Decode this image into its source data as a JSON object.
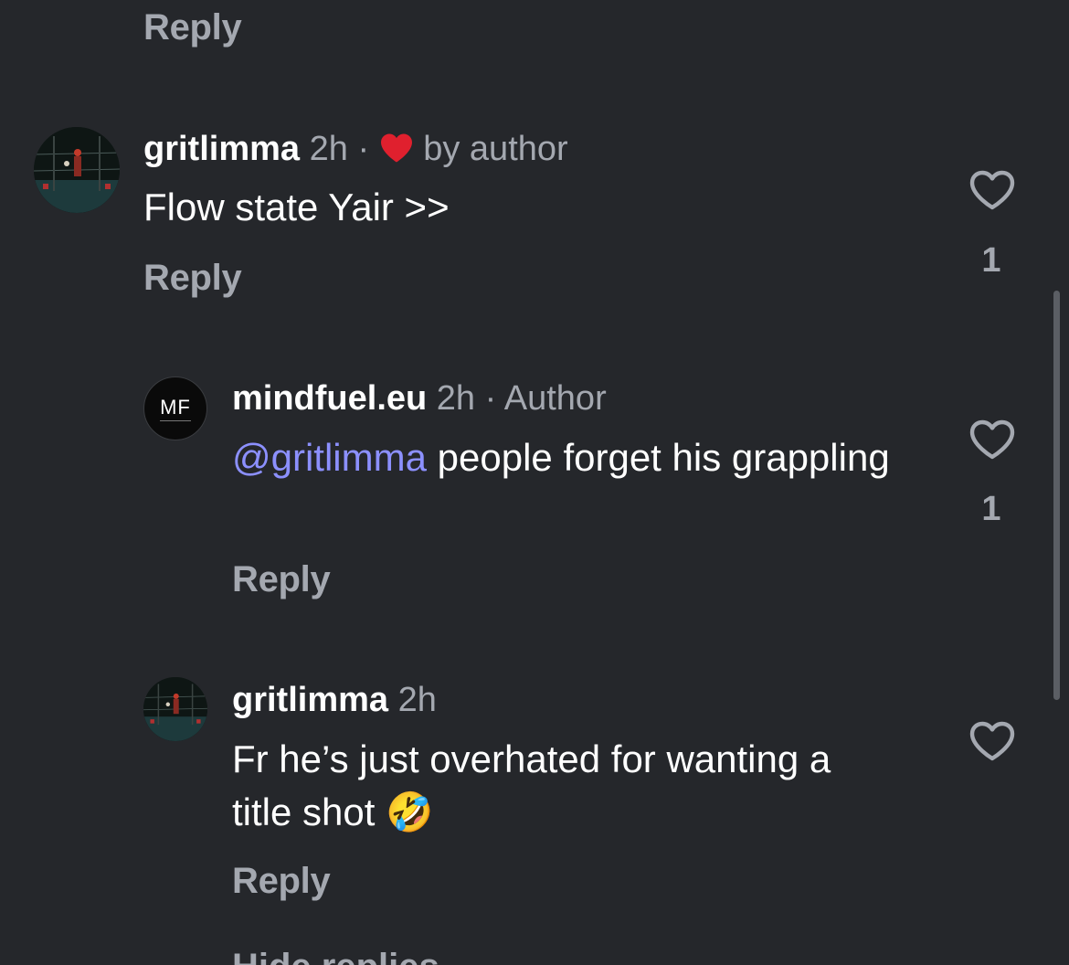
{
  "top_reply": {
    "reply_label": "Reply"
  },
  "comments": [
    {
      "username": "gritlimma",
      "time": "2h",
      "separator": "·",
      "badge": "by author",
      "badge_icon": "red-heart-icon",
      "text": "Flow state Yair >>",
      "reply_label": "Reply",
      "like_count": "1",
      "liked_by_author": true
    },
    {
      "username": "mindfuel.eu",
      "time": "2h",
      "separator": "·",
      "badge": "Author",
      "avatar_text": "MF",
      "mention": "@gritlimma",
      "text_rest": " people forget his grappling",
      "reply_label": "Reply",
      "like_count": "1"
    },
    {
      "username": "gritlimma",
      "time": "2h",
      "text": "Fr he’s just overhated for wanting a title shot",
      "emoji": "🤣",
      "reply_label": "Reply"
    }
  ],
  "hide_replies_label": "Hide replies",
  "colors": {
    "background": "#25272b",
    "muted_text": "#a4a8b0",
    "mention": "#8c90ff",
    "heart": "#e0202e"
  }
}
